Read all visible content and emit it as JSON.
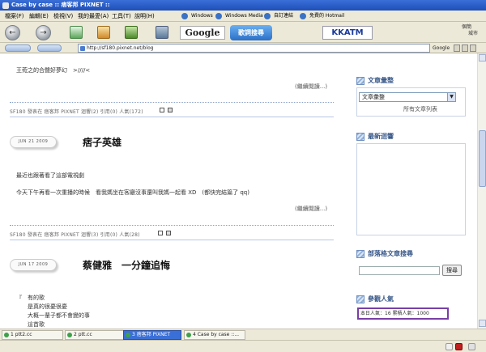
{
  "window": {
    "title": "Case by case :: 痞客邦 PIXNET ::"
  },
  "menu": {
    "items": [
      "檔案(F)",
      "編輯(E)",
      "檢視(V)",
      "我的最愛(A)",
      "工具(T)",
      "說明(H)"
    ]
  },
  "links": [
    "Windows",
    "Windows Media",
    "自訂連結",
    "免費的 Hotmail"
  ],
  "toolbar": {
    "google_label": "Google",
    "song_search_label": "歌詞搜尋",
    "kkatm_label": "KKATM",
    "profile_name_1": "個簡",
    "profile_name_2": "城市"
  },
  "address": {
    "url": "http://sf180.pixnet.net/blog",
    "search_engine": "Google"
  },
  "post1_tail": {
    "text": "王菀之的合聲好夢幻　>////<",
    "more": "(繼續閱讀...)",
    "meta": "SF180 發表在 痞客邦 PIXNET 迴響(2) 引用(0) 人氣(172)"
  },
  "post2": {
    "date": "JUN 21 2009",
    "title": "痞子英雄",
    "line1": "最近也跟著看了這部電視劇",
    "line2": "今天下午再看一次重播的時候　看我媽坐在客廳沒事還叫我媽一起看 XD　(都快完結篇了 qq)",
    "more": "(繼續閱讀...)",
    "meta": "SF180 發表在 痞客邦 PIXNET 迴響(3) 引用(0) 人氣(28)"
  },
  "post3": {
    "date": "JUN 17 2009",
    "title": "蔡健雅　一分鐘追悔",
    "lines": [
      "『　有的歌",
      "　　是真的很憂很憂",
      "　　大概一輩子都不會變的事",
      "　　這首歌"
    ]
  },
  "sidebar": {
    "archive_title": "文章彙整",
    "archive_select": "文章彙整",
    "archive_link": "所有文章列表",
    "recent_title": "最新迴響",
    "search_title": "部落格文章搜尋",
    "search_button": "搜尋",
    "visitors_title": "參觀人氣",
    "visitors_text": "本日人氣：16 累積人氣：1000"
  },
  "taskbar": {
    "tasks": [
      "1 ptt2.cc",
      "2 ptt.cc",
      "3 痞客邦 PIXNET",
      "4 Case by case ::..."
    ]
  }
}
